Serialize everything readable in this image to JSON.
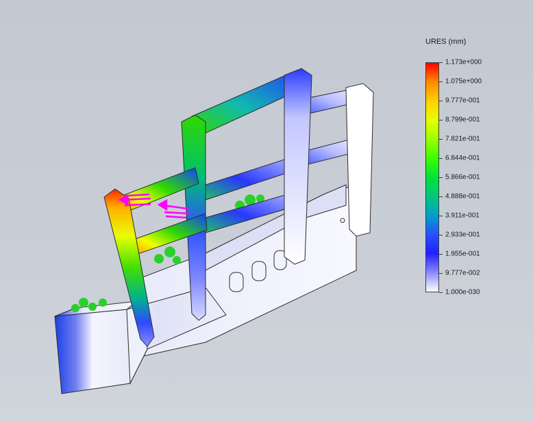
{
  "legend": {
    "title": "URES (mm)",
    "ticks": [
      "1.173e+000",
      "1.075e+000",
      "9.777e-001",
      "8.799e-001",
      "7.821e-001",
      "6.844e-001",
      "5.866e-001",
      "4.888e-001",
      "3.911e-001",
      "2.933e-001",
      "1.955e-001",
      "9.777e-002",
      "1.000e-030"
    ],
    "colors": [
      "#ff0000",
      "#ff8a00",
      "#ffd000",
      "#e6ff00",
      "#9cff00",
      "#3aff00",
      "#00e23a",
      "#00c87a",
      "#00a0c8",
      "#2a50ff",
      "#2020ff",
      "#8a8aff",
      "#ffffff"
    ]
  },
  "model": {
    "part": "bumper-guard",
    "colors": {
      "max": "#ff2a00",
      "mid": "#30e000",
      "low": "#2838ff",
      "min": "#ffffff",
      "fixture": "#2ad02a",
      "load": "#ff00ff"
    }
  }
}
